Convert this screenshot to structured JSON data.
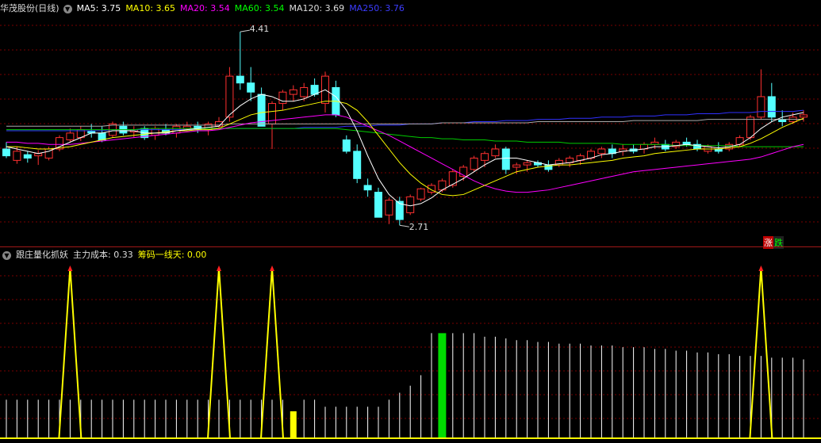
{
  "top_legend": {
    "stock_name": "华茂股份(日线)",
    "ma5": "MA5: 3.75",
    "ma10": "MA10: 3.65",
    "ma20": "MA20: 3.54",
    "ma60": "MA60: 3.54",
    "ma120": "MA120: 3.69",
    "ma250": "MA250: 3.76"
  },
  "bottom_legend": {
    "indicator_name": "跟庄量化抓妖",
    "main_cost": "主力成本: 0.33",
    "chip_line": "筹码一线天: 0.00"
  },
  "annotations": {
    "high": "4.41",
    "low": "2.71"
  },
  "buttons": {
    "up": "涨",
    "down": "跌"
  },
  "colors": {
    "up": "#ff3030",
    "down": "#54ffff",
    "ma5": "#ffffff",
    "ma10": "#ffff00",
    "ma20": "#ff00ff",
    "ma60": "#00cc00",
    "ma120": "#aaaaaa",
    "ma250": "#3030ff",
    "grid": "#7a0000",
    "signal": "#ffff00",
    "bar_green": "#00dd00"
  },
  "chart_data": {
    "type": "candlestick",
    "price_range": [
      2.6,
      4.55
    ],
    "candles": [
      [
        3.38,
        3.44,
        3.3,
        3.32
      ],
      [
        3.28,
        3.4,
        3.25,
        3.36
      ],
      [
        3.33,
        3.36,
        3.26,
        3.3
      ],
      [
        3.32,
        3.37,
        3.24,
        3.34
      ],
      [
        3.3,
        3.4,
        3.28,
        3.38
      ],
      [
        3.38,
        3.5,
        3.36,
        3.48
      ],
      [
        3.46,
        3.56,
        3.44,
        3.52
      ],
      [
        3.48,
        3.58,
        3.45,
        3.55
      ],
      [
        3.54,
        3.6,
        3.48,
        3.52
      ],
      [
        3.52,
        3.58,
        3.44,
        3.46
      ],
      [
        3.5,
        3.62,
        3.48,
        3.6
      ],
      [
        3.58,
        3.62,
        3.5,
        3.52
      ],
      [
        3.53,
        3.58,
        3.48,
        3.55
      ],
      [
        3.56,
        3.58,
        3.46,
        3.48
      ],
      [
        3.5,
        3.58,
        3.46,
        3.56
      ],
      [
        3.55,
        3.6,
        3.5,
        3.52
      ],
      [
        3.52,
        3.6,
        3.48,
        3.58
      ],
      [
        3.56,
        3.62,
        3.54,
        3.58
      ],
      [
        3.58,
        3.62,
        3.52,
        3.55
      ],
      [
        3.55,
        3.62,
        3.5,
        3.6
      ],
      [
        3.58,
        3.66,
        3.56,
        3.62
      ],
      [
        3.66,
        4.1,
        3.62,
        4.02
      ],
      [
        4.02,
        4.41,
        3.9,
        3.96
      ],
      [
        3.96,
        4.1,
        3.8,
        3.88
      ],
      [
        3.86,
        3.92,
        3.6,
        3.58
      ],
      [
        3.6,
        3.8,
        3.38,
        3.78
      ],
      [
        3.78,
        3.9,
        3.72,
        3.88
      ],
      [
        3.86,
        3.94,
        3.8,
        3.9
      ],
      [
        3.84,
        3.96,
        3.8,
        3.92
      ],
      [
        3.94,
        4.0,
        3.84,
        3.86
      ],
      [
        3.78,
        4.06,
        3.7,
        4.02
      ],
      [
        3.92,
        3.98,
        3.66,
        3.68
      ],
      [
        3.46,
        3.5,
        3.34,
        3.36
      ],
      [
        3.36,
        3.42,
        3.08,
        3.12
      ],
      [
        3.06,
        3.12,
        2.96,
        3.02
      ],
      [
        3.0,
        3.04,
        2.82,
        2.78
      ],
      [
        2.8,
        2.95,
        2.72,
        2.93
      ],
      [
        2.92,
        2.96,
        2.71,
        2.76
      ],
      [
        2.82,
        2.98,
        2.8,
        2.96
      ],
      [
        2.94,
        3.04,
        2.92,
        3.03
      ],
      [
        3.0,
        3.08,
        2.98,
        3.06
      ],
      [
        3.02,
        3.12,
        3.0,
        3.1
      ],
      [
        3.06,
        3.2,
        3.04,
        3.18
      ],
      [
        3.14,
        3.24,
        3.1,
        3.22
      ],
      [
        3.2,
        3.32,
        3.18,
        3.3
      ],
      [
        3.28,
        3.36,
        3.22,
        3.34
      ],
      [
        3.32,
        3.42,
        3.3,
        3.38
      ],
      [
        3.38,
        3.4,
        3.16,
        3.2
      ],
      [
        3.22,
        3.26,
        3.16,
        3.24
      ],
      [
        3.24,
        3.28,
        3.18,
        3.26
      ],
      [
        3.26,
        3.28,
        3.22,
        3.24
      ],
      [
        3.24,
        3.28,
        3.18,
        3.2
      ],
      [
        3.24,
        3.3,
        3.22,
        3.28
      ],
      [
        3.26,
        3.32,
        3.22,
        3.3
      ],
      [
        3.28,
        3.34,
        3.24,
        3.32
      ],
      [
        3.3,
        3.38,
        3.28,
        3.36
      ],
      [
        3.34,
        3.4,
        3.3,
        3.38
      ],
      [
        3.38,
        3.42,
        3.3,
        3.34
      ],
      [
        3.36,
        3.42,
        3.32,
        3.38
      ],
      [
        3.38,
        3.42,
        3.34,
        3.36
      ],
      [
        3.38,
        3.44,
        3.34,
        3.42
      ],
      [
        3.42,
        3.48,
        3.38,
        3.44
      ],
      [
        3.42,
        3.46,
        3.36,
        3.38
      ],
      [
        3.4,
        3.46,
        3.38,
        3.44
      ],
      [
        3.44,
        3.48,
        3.4,
        3.42
      ],
      [
        3.42,
        3.46,
        3.36,
        3.38
      ],
      [
        3.36,
        3.42,
        3.34,
        3.4
      ],
      [
        3.38,
        3.44,
        3.34,
        3.36
      ],
      [
        3.38,
        3.44,
        3.36,
        3.42
      ],
      [
        3.42,
        3.5,
        3.4,
        3.48
      ],
      [
        3.48,
        3.68,
        3.46,
        3.66
      ],
      [
        3.66,
        4.08,
        3.64,
        3.84
      ],
      [
        3.84,
        3.96,
        3.62,
        3.66
      ],
      [
        3.64,
        3.72,
        3.58,
        3.62
      ],
      [
        3.62,
        3.7,
        3.6,
        3.66
      ],
      [
        3.66,
        3.72,
        3.62,
        3.68
      ]
    ],
    "ma5": [
      3.4,
      3.38,
      3.36,
      3.34,
      3.36,
      3.4,
      3.44,
      3.48,
      3.52,
      3.52,
      3.54,
      3.54,
      3.54,
      3.52,
      3.52,
      3.52,
      3.54,
      3.55,
      3.56,
      3.57,
      3.58,
      3.68,
      3.76,
      3.82,
      3.86,
      3.84,
      3.8,
      3.8,
      3.82,
      3.86,
      3.9,
      3.84,
      3.72,
      3.54,
      3.32,
      3.12,
      2.98,
      2.9,
      2.88,
      2.9,
      2.95,
      3.02,
      3.07,
      3.12,
      3.18,
      3.24,
      3.29,
      3.3,
      3.3,
      3.28,
      3.26,
      3.24,
      3.25,
      3.26,
      3.28,
      3.3,
      3.33,
      3.34,
      3.36,
      3.37,
      3.38,
      3.4,
      3.4,
      3.41,
      3.42,
      3.41,
      3.4,
      3.39,
      3.4,
      3.42,
      3.48,
      3.56,
      3.62,
      3.66,
      3.68,
      3.7
    ],
    "ma10": [
      3.4,
      3.4,
      3.39,
      3.38,
      3.38,
      3.39,
      3.4,
      3.42,
      3.44,
      3.46,
      3.48,
      3.49,
      3.5,
      3.51,
      3.52,
      3.53,
      3.54,
      3.54,
      3.55,
      3.55,
      3.56,
      3.6,
      3.64,
      3.68,
      3.7,
      3.71,
      3.72,
      3.74,
      3.76,
      3.78,
      3.8,
      3.8,
      3.78,
      3.72,
      3.62,
      3.5,
      3.38,
      3.26,
      3.16,
      3.08,
      3.02,
      2.98,
      2.97,
      2.98,
      3.02,
      3.06,
      3.1,
      3.14,
      3.18,
      3.2,
      3.22,
      3.23,
      3.24,
      3.24,
      3.25,
      3.26,
      3.27,
      3.28,
      3.3,
      3.31,
      3.32,
      3.34,
      3.35,
      3.36,
      3.37,
      3.38,
      3.38,
      3.38,
      3.39,
      3.4,
      3.43,
      3.47,
      3.52,
      3.57,
      3.61,
      3.65
    ],
    "ma20": [
      3.44,
      3.44,
      3.43,
      3.43,
      3.42,
      3.42,
      3.42,
      3.43,
      3.44,
      3.45,
      3.46,
      3.47,
      3.48,
      3.49,
      3.5,
      3.51,
      3.52,
      3.53,
      3.54,
      3.54,
      3.55,
      3.57,
      3.59,
      3.61,
      3.62,
      3.63,
      3.64,
      3.65,
      3.66,
      3.67,
      3.68,
      3.68,
      3.66,
      3.62,
      3.58,
      3.54,
      3.5,
      3.45,
      3.4,
      3.35,
      3.3,
      3.25,
      3.2,
      3.15,
      3.1,
      3.06,
      3.03,
      3.01,
      3.0,
      3.0,
      3.01,
      3.02,
      3.04,
      3.06,
      3.08,
      3.1,
      3.12,
      3.14,
      3.16,
      3.18,
      3.19,
      3.2,
      3.21,
      3.22,
      3.23,
      3.24,
      3.25,
      3.26,
      3.27,
      3.28,
      3.29,
      3.31,
      3.34,
      3.37,
      3.4,
      3.42
    ],
    "ma60": [
      3.55,
      3.55,
      3.55,
      3.55,
      3.55,
      3.55,
      3.55,
      3.55,
      3.55,
      3.55,
      3.55,
      3.55,
      3.55,
      3.56,
      3.56,
      3.56,
      3.56,
      3.56,
      3.56,
      3.56,
      3.56,
      3.56,
      3.56,
      3.56,
      3.56,
      3.56,
      3.56,
      3.56,
      3.56,
      3.56,
      3.56,
      3.56,
      3.55,
      3.54,
      3.53,
      3.52,
      3.51,
      3.5,
      3.49,
      3.48,
      3.48,
      3.47,
      3.47,
      3.46,
      3.46,
      3.46,
      3.45,
      3.45,
      3.45,
      3.44,
      3.44,
      3.44,
      3.44,
      3.43,
      3.43,
      3.43,
      3.43,
      3.43,
      3.42,
      3.42,
      3.42,
      3.42,
      3.42,
      3.41,
      3.41,
      3.41,
      3.41,
      3.41,
      3.41,
      3.4,
      3.4,
      3.4,
      3.4,
      3.4,
      3.4,
      3.4
    ],
    "ma120": [
      3.58,
      3.58,
      3.58,
      3.58,
      3.58,
      3.58,
      3.58,
      3.58,
      3.58,
      3.58,
      3.59,
      3.59,
      3.59,
      3.59,
      3.59,
      3.59,
      3.59,
      3.59,
      3.59,
      3.59,
      3.59,
      3.6,
      3.6,
      3.6,
      3.6,
      3.6,
      3.6,
      3.6,
      3.6,
      3.6,
      3.6,
      3.6,
      3.6,
      3.6,
      3.6,
      3.6,
      3.6,
      3.6,
      3.6,
      3.6,
      3.6,
      3.61,
      3.61,
      3.61,
      3.61,
      3.61,
      3.61,
      3.61,
      3.61,
      3.61,
      3.62,
      3.62,
      3.62,
      3.62,
      3.62,
      3.62,
      3.62,
      3.62,
      3.62,
      3.63,
      3.63,
      3.63,
      3.63,
      3.63,
      3.63,
      3.63,
      3.64,
      3.64,
      3.64,
      3.64,
      3.64,
      3.64,
      3.64,
      3.64,
      3.64,
      3.64
    ],
    "ma250": [
      3.54,
      3.54,
      3.54,
      3.54,
      3.54,
      3.54,
      3.54,
      3.54,
      3.54,
      3.54,
      3.55,
      3.55,
      3.55,
      3.55,
      3.55,
      3.55,
      3.55,
      3.55,
      3.55,
      3.55,
      3.56,
      3.56,
      3.56,
      3.56,
      3.56,
      3.56,
      3.56,
      3.56,
      3.57,
      3.57,
      3.57,
      3.57,
      3.58,
      3.58,
      3.58,
      3.59,
      3.59,
      3.59,
      3.6,
      3.6,
      3.6,
      3.61,
      3.61,
      3.61,
      3.62,
      3.62,
      3.62,
      3.63,
      3.63,
      3.63,
      3.64,
      3.64,
      3.64,
      3.65,
      3.65,
      3.65,
      3.66,
      3.66,
      3.66,
      3.67,
      3.67,
      3.67,
      3.68,
      3.68,
      3.68,
      3.69,
      3.69,
      3.69,
      3.7,
      3.7,
      3.7,
      3.71,
      3.71,
      3.71,
      3.71,
      3.72
    ],
    "volume_heights": [
      0.22,
      0.22,
      0.22,
      0.22,
      0.22,
      0.22,
      0.22,
      0.22,
      0.22,
      0.22,
      0.22,
      0.22,
      0.22,
      0.22,
      0.22,
      0.22,
      0.22,
      0.22,
      0.22,
      0.22,
      0.22,
      0.22,
      0.22,
      0.22,
      0.22,
      0.22,
      0.22,
      0.22,
      0.22,
      0.22,
      0.18,
      0.18,
      0.18,
      0.18,
      0.18,
      0.18,
      0.22,
      0.26,
      0.3,
      0.36,
      0.6,
      0.6,
      0.6,
      0.6,
      0.6,
      0.58,
      0.58,
      0.57,
      0.56,
      0.56,
      0.55,
      0.55,
      0.54,
      0.54,
      0.54,
      0.53,
      0.53,
      0.53,
      0.52,
      0.52,
      0.52,
      0.51,
      0.51,
      0.5,
      0.5,
      0.49,
      0.49,
      0.48,
      0.48,
      0.47,
      0.47,
      0.47,
      0.46,
      0.46,
      0.46,
      0.45
    ],
    "green_bar_index": 41,
    "yellow_bar_index": 27,
    "signal_indices": [
      6,
      20,
      25,
      71
    ]
  }
}
